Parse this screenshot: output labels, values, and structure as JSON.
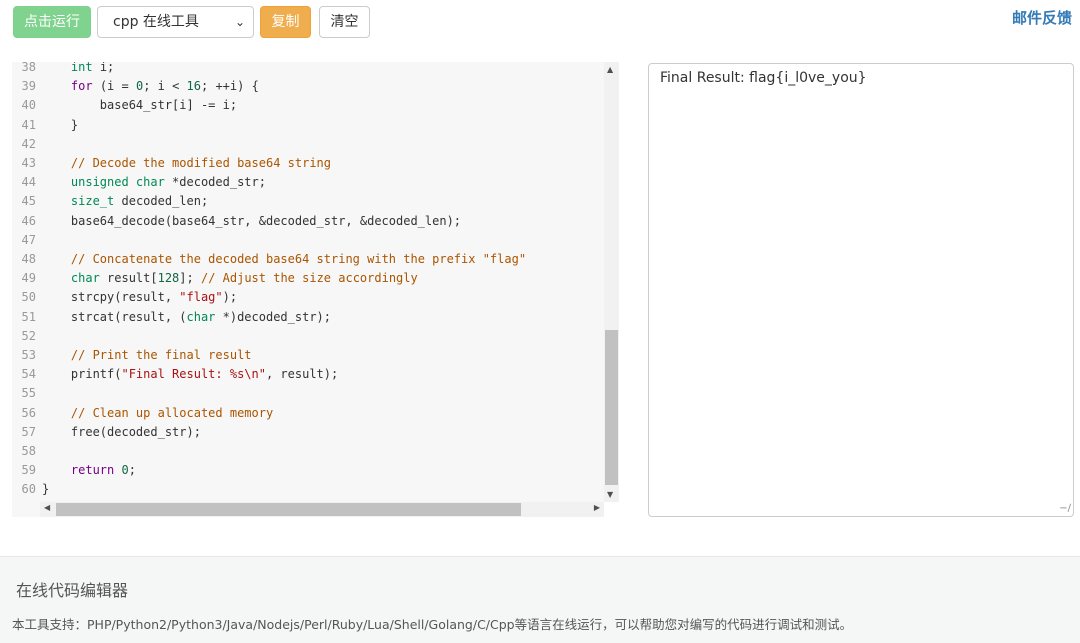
{
  "toolbar": {
    "run_label": "点击运行",
    "lang_selected": "cpp 在线工具",
    "copy_label": "复制",
    "clear_label": "清空",
    "feedback_label": "邮件反馈"
  },
  "editor": {
    "line_numbers": [
      "38",
      "39",
      "40",
      "41",
      "42",
      "43",
      "44",
      "45",
      "46",
      "47",
      "48",
      "49",
      "50",
      "51",
      "52",
      "53",
      "54",
      "55",
      "56",
      "57",
      "58",
      "59",
      "60"
    ]
  },
  "output": {
    "text": "Final Result: flag{i_l0ve_you}"
  },
  "footer": {
    "title": "在线代码编辑器",
    "description": "本工具支持：PHP/Python2/Python3/Java/Nodejs/Perl/Ruby/Lua/Shell/Golang/C/Cpp等语言在线运行，可以帮助您对编写的代码进行调试和测试。"
  },
  "colors": {
    "run_button": "#7fd38f",
    "copy_button": "#f0ad4e",
    "feedback_link": "#337ab7"
  }
}
